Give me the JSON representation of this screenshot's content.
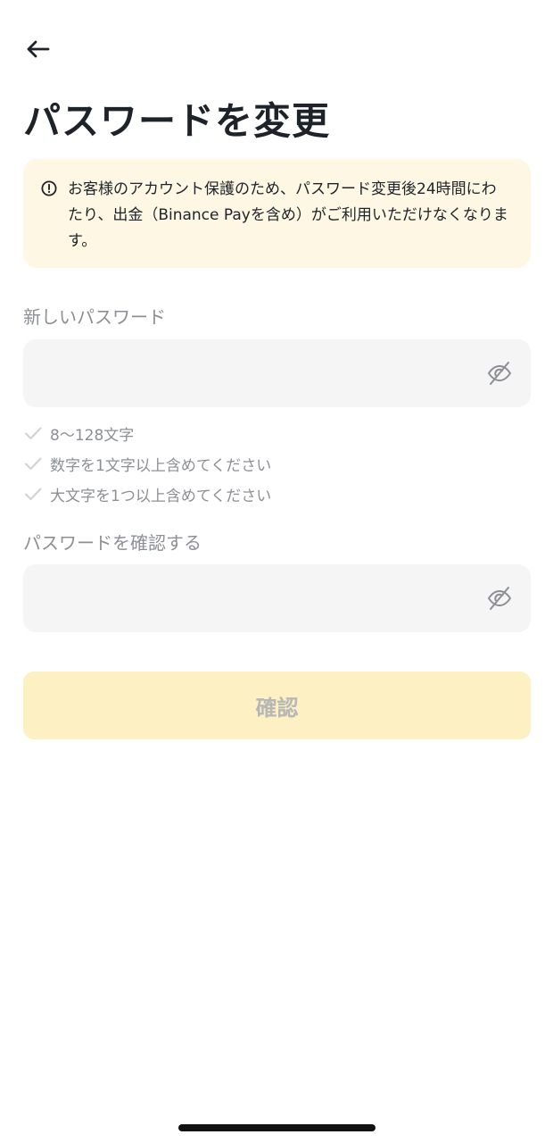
{
  "header": {
    "back_icon": "arrow-left-icon",
    "title": "パスワードを変更"
  },
  "notice": {
    "icon": "exclamation-circle-icon",
    "text": "お客様のアカウント保護のため、パスワード変更後24時間にわたり、出金（Binance Payを含め）がご利用いただけなくなります。"
  },
  "new_password": {
    "label": "新しいパスワード",
    "value": "",
    "toggle_icon": "eye-off-icon"
  },
  "rules": [
    {
      "text": "8〜128文字",
      "icon": "check-icon"
    },
    {
      "text": "数字を1文字以上含めてください",
      "icon": "check-icon"
    },
    {
      "text": "大文字を1つ以上含めてください",
      "icon": "check-icon"
    }
  ],
  "confirm_password": {
    "label": "パスワードを確認する",
    "value": "",
    "toggle_icon": "eye-off-icon"
  },
  "submit": {
    "label": "確認"
  },
  "colors": {
    "notice_bg": "#fdf7e3",
    "input_bg": "#f5f5f5",
    "button_disabled_bg": "#fdf0c3",
    "muted_text": "#8c8f94"
  }
}
